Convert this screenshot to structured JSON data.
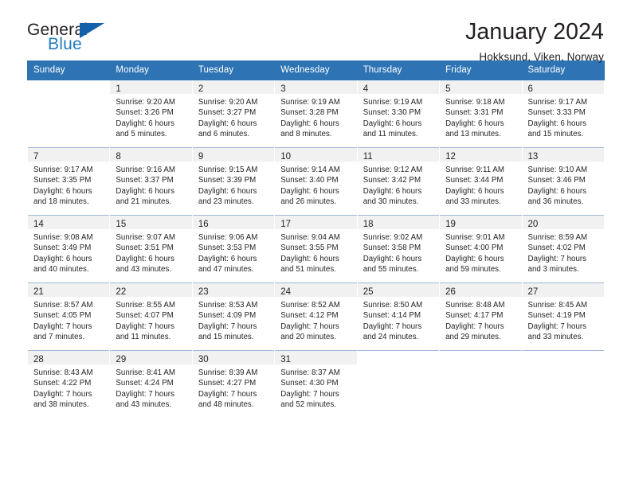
{
  "brand": {
    "name_part1": "General",
    "name_part2": "Blue",
    "accent_color": "#1f7ac0",
    "flag_color": "#1361a8"
  },
  "header": {
    "title": "January 2024",
    "subtitle": "Hokksund, Viken, Norway"
  },
  "theme": {
    "header_bg": "#2e74b5",
    "header_text": "#ffffff",
    "daynum_bg": "#f1f1f1",
    "text": "#231f20"
  },
  "weekdays": [
    "Sunday",
    "Monday",
    "Tuesday",
    "Wednesday",
    "Thursday",
    "Friday",
    "Saturday"
  ],
  "labels": {
    "sunrise_prefix": "Sunrise:",
    "sunset_prefix": "Sunset:",
    "daylight_prefix": "Daylight:"
  },
  "weeks": [
    [
      {
        "day": "",
        "lines": [
          "",
          "",
          "",
          ""
        ]
      },
      {
        "day": "1",
        "lines": [
          "Sunrise: 9:20 AM",
          "Sunset: 3:26 PM",
          "Daylight: 6 hours",
          "and 5 minutes."
        ]
      },
      {
        "day": "2",
        "lines": [
          "Sunrise: 9:20 AM",
          "Sunset: 3:27 PM",
          "Daylight: 6 hours",
          "and 6 minutes."
        ]
      },
      {
        "day": "3",
        "lines": [
          "Sunrise: 9:19 AM",
          "Sunset: 3:28 PM",
          "Daylight: 6 hours",
          "and 8 minutes."
        ]
      },
      {
        "day": "4",
        "lines": [
          "Sunrise: 9:19 AM",
          "Sunset: 3:30 PM",
          "Daylight: 6 hours",
          "and 11 minutes."
        ]
      },
      {
        "day": "5",
        "lines": [
          "Sunrise: 9:18 AM",
          "Sunset: 3:31 PM",
          "Daylight: 6 hours",
          "and 13 minutes."
        ]
      },
      {
        "day": "6",
        "lines": [
          "Sunrise: 9:17 AM",
          "Sunset: 3:33 PM",
          "Daylight: 6 hours",
          "and 15 minutes."
        ]
      }
    ],
    [
      {
        "day": "7",
        "lines": [
          "Sunrise: 9:17 AM",
          "Sunset: 3:35 PM",
          "Daylight: 6 hours",
          "and 18 minutes."
        ]
      },
      {
        "day": "8",
        "lines": [
          "Sunrise: 9:16 AM",
          "Sunset: 3:37 PM",
          "Daylight: 6 hours",
          "and 21 minutes."
        ]
      },
      {
        "day": "9",
        "lines": [
          "Sunrise: 9:15 AM",
          "Sunset: 3:39 PM",
          "Daylight: 6 hours",
          "and 23 minutes."
        ]
      },
      {
        "day": "10",
        "lines": [
          "Sunrise: 9:14 AM",
          "Sunset: 3:40 PM",
          "Daylight: 6 hours",
          "and 26 minutes."
        ]
      },
      {
        "day": "11",
        "lines": [
          "Sunrise: 9:12 AM",
          "Sunset: 3:42 PM",
          "Daylight: 6 hours",
          "and 30 minutes."
        ]
      },
      {
        "day": "12",
        "lines": [
          "Sunrise: 9:11 AM",
          "Sunset: 3:44 PM",
          "Daylight: 6 hours",
          "and 33 minutes."
        ]
      },
      {
        "day": "13",
        "lines": [
          "Sunrise: 9:10 AM",
          "Sunset: 3:46 PM",
          "Daylight: 6 hours",
          "and 36 minutes."
        ]
      }
    ],
    [
      {
        "day": "14",
        "lines": [
          "Sunrise: 9:08 AM",
          "Sunset: 3:49 PM",
          "Daylight: 6 hours",
          "and 40 minutes."
        ]
      },
      {
        "day": "15",
        "lines": [
          "Sunrise: 9:07 AM",
          "Sunset: 3:51 PM",
          "Daylight: 6 hours",
          "and 43 minutes."
        ]
      },
      {
        "day": "16",
        "lines": [
          "Sunrise: 9:06 AM",
          "Sunset: 3:53 PM",
          "Daylight: 6 hours",
          "and 47 minutes."
        ]
      },
      {
        "day": "17",
        "lines": [
          "Sunrise: 9:04 AM",
          "Sunset: 3:55 PM",
          "Daylight: 6 hours",
          "and 51 minutes."
        ]
      },
      {
        "day": "18",
        "lines": [
          "Sunrise: 9:02 AM",
          "Sunset: 3:58 PM",
          "Daylight: 6 hours",
          "and 55 minutes."
        ]
      },
      {
        "day": "19",
        "lines": [
          "Sunrise: 9:01 AM",
          "Sunset: 4:00 PM",
          "Daylight: 6 hours",
          "and 59 minutes."
        ]
      },
      {
        "day": "20",
        "lines": [
          "Sunrise: 8:59 AM",
          "Sunset: 4:02 PM",
          "Daylight: 7 hours",
          "and 3 minutes."
        ]
      }
    ],
    [
      {
        "day": "21",
        "lines": [
          "Sunrise: 8:57 AM",
          "Sunset: 4:05 PM",
          "Daylight: 7 hours",
          "and 7 minutes."
        ]
      },
      {
        "day": "22",
        "lines": [
          "Sunrise: 8:55 AM",
          "Sunset: 4:07 PM",
          "Daylight: 7 hours",
          "and 11 minutes."
        ]
      },
      {
        "day": "23",
        "lines": [
          "Sunrise: 8:53 AM",
          "Sunset: 4:09 PM",
          "Daylight: 7 hours",
          "and 15 minutes."
        ]
      },
      {
        "day": "24",
        "lines": [
          "Sunrise: 8:52 AM",
          "Sunset: 4:12 PM",
          "Daylight: 7 hours",
          "and 20 minutes."
        ]
      },
      {
        "day": "25",
        "lines": [
          "Sunrise: 8:50 AM",
          "Sunset: 4:14 PM",
          "Daylight: 7 hours",
          "and 24 minutes."
        ]
      },
      {
        "day": "26",
        "lines": [
          "Sunrise: 8:48 AM",
          "Sunset: 4:17 PM",
          "Daylight: 7 hours",
          "and 29 minutes."
        ]
      },
      {
        "day": "27",
        "lines": [
          "Sunrise: 8:45 AM",
          "Sunset: 4:19 PM",
          "Daylight: 7 hours",
          "and 33 minutes."
        ]
      }
    ],
    [
      {
        "day": "28",
        "lines": [
          "Sunrise: 8:43 AM",
          "Sunset: 4:22 PM",
          "Daylight: 7 hours",
          "and 38 minutes."
        ]
      },
      {
        "day": "29",
        "lines": [
          "Sunrise: 8:41 AM",
          "Sunset: 4:24 PM",
          "Daylight: 7 hours",
          "and 43 minutes."
        ]
      },
      {
        "day": "30",
        "lines": [
          "Sunrise: 8:39 AM",
          "Sunset: 4:27 PM",
          "Daylight: 7 hours",
          "and 48 minutes."
        ]
      },
      {
        "day": "31",
        "lines": [
          "Sunrise: 8:37 AM",
          "Sunset: 4:30 PM",
          "Daylight: 7 hours",
          "and 52 minutes."
        ]
      },
      {
        "day": "",
        "lines": [
          "",
          "",
          "",
          ""
        ]
      },
      {
        "day": "",
        "lines": [
          "",
          "",
          "",
          ""
        ]
      },
      {
        "day": "",
        "lines": [
          "",
          "",
          "",
          ""
        ]
      }
    ]
  ]
}
